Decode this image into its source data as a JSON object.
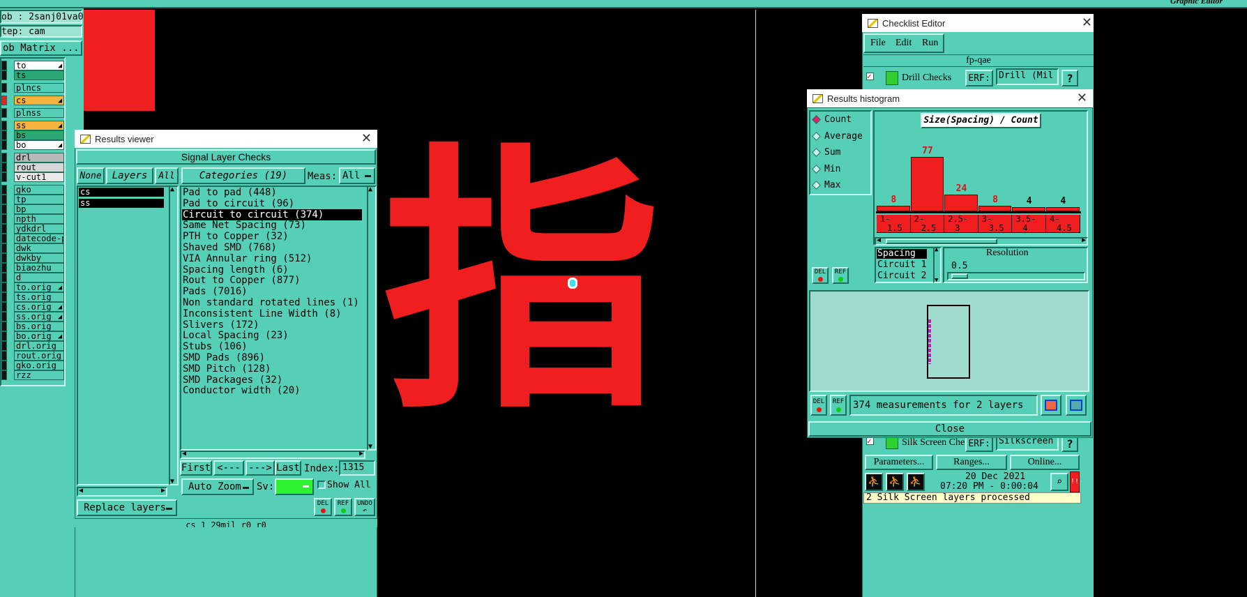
{
  "left_panel": {
    "job": "ob : 2sanj01va0",
    "step": "tep: cam",
    "matrix_button": "ob Matrix ...",
    "layers": [
      {
        "name": "to",
        "color": "#ffffff",
        "arrow": "◢"
      },
      {
        "name": "ts",
        "color": "#2aa876",
        "arrow": ""
      },
      {
        "name": "plncs",
        "color": "#56cfb7",
        "arrow": ""
      },
      {
        "name": "cs",
        "color": "#f5b340",
        "arrow": "◢"
      },
      {
        "name": "plnss",
        "color": "#56cfb7",
        "arrow": ""
      },
      {
        "name": "ss",
        "color": "#f5b340",
        "arrow": "◢"
      },
      {
        "name": "bs",
        "color": "#2aa876",
        "arrow": ""
      },
      {
        "name": "bo",
        "color": "#ffffff",
        "arrow": "◢"
      },
      {
        "name": "drl",
        "color": "#b9b9b9",
        "arrow": ""
      },
      {
        "name": "rout",
        "color": "#d6d6d6",
        "arrow": ""
      },
      {
        "name": "v-cut1",
        "color": "#e8e8e8",
        "arrow": ""
      },
      {
        "name": "gko",
        "color": "#56cfb7",
        "arrow": ""
      },
      {
        "name": "tp",
        "color": "#56cfb7",
        "arrow": ""
      },
      {
        "name": "bp",
        "color": "#56cfb7",
        "arrow": ""
      },
      {
        "name": "npth",
        "color": "#56cfb7",
        "arrow": ""
      },
      {
        "name": "ydkdrl",
        "color": "#56cfb7",
        "arrow": ""
      },
      {
        "name": "datecode-pt",
        "color": "#56cfb7",
        "arrow": ""
      },
      {
        "name": "dwk",
        "color": "#56cfb7",
        "arrow": ""
      },
      {
        "name": "dwkby",
        "color": "#56cfb7",
        "arrow": ""
      },
      {
        "name": "biaozhu",
        "color": "#56cfb7",
        "arrow": ""
      },
      {
        "name": "d",
        "color": "#56cfb7",
        "arrow": ""
      },
      {
        "name": "to.orig",
        "color": "#56cfb7",
        "arrow": "◢"
      },
      {
        "name": "ts.orig",
        "color": "#56cfb7",
        "arrow": ""
      },
      {
        "name": "cs.orig",
        "color": "#56cfb7",
        "arrow": "◢"
      },
      {
        "name": "ss.orig",
        "color": "#56cfb7",
        "arrow": "◢"
      },
      {
        "name": "bs.orig",
        "color": "#56cfb7",
        "arrow": ""
      },
      {
        "name": "bo.orig",
        "color": "#56cfb7",
        "arrow": "◢"
      },
      {
        "name": "drl.orig",
        "color": "#56cfb7",
        "arrow": ""
      },
      {
        "name": "rout.orig",
        "color": "#56cfb7",
        "arrow": ""
      },
      {
        "name": "gko.orig",
        "color": "#56cfb7",
        "arrow": ""
      },
      {
        "name": "rzz",
        "color": "#56cfb7",
        "arrow": ""
      }
    ]
  },
  "top_right_title": "Graphic Editor",
  "canvas_char": "指",
  "results_viewer": {
    "title": "Results viewer",
    "header": "Signal Layer Checks",
    "none_btn": "None",
    "layers_btn": "Layers",
    "all_btn": "All",
    "categories_btn": "Categories (19)",
    "meas_label": "Meas:",
    "meas_value": "All",
    "layers": [
      "cs",
      "ss"
    ],
    "categories": [
      "Pad to pad (448)",
      "Pad to circuit (96)",
      "Circuit to circuit (374)",
      "Same Net Spacing (73)",
      "PTH to Copper (32)",
      "Shaved SMD (768)",
      "VIA Annular ring (512)",
      "Spacing length (6)",
      "Rout to Copper (877)",
      "Pads (7016)",
      "Non standard rotated lines (1)",
      "Inconsistent Line Width (8)",
      "Slivers (172)",
      "Local Spacing (23)",
      "Stubs (106)",
      "SMD Pads (896)",
      "SMD Pitch (128)",
      "SMD Packages (32)",
      "Conductor width (20)"
    ],
    "selected_category_index": 2,
    "first_btn": "First",
    "prev_btn": "<---",
    "next_btn": "--->",
    "last_btn": "Last",
    "index_label": "Index:",
    "index_value": "1315",
    "auto_zoom": "Auto Zoom",
    "sv_label": "Sv:",
    "show_all": "Show All",
    "replace_layers": "Replace layers",
    "del": "DEL",
    "ref": "REF",
    "undo": "UNDO",
    "status": "cs 1 29mil  r0  r0"
  },
  "checklist_editor": {
    "title": "Checklist Editor",
    "menu": [
      "File",
      "Edit",
      "Run"
    ],
    "name": "fp-qae",
    "drill_row": {
      "label": "Drill Checks",
      "erf": "ERF:",
      "value": "Drill (Mil"
    },
    "silk_row": {
      "label": "Silk Screen Che",
      "erf": "ERF:",
      "value": "Silkscreen"
    },
    "parameters_btn": "Parameters...",
    "ranges_btn": "Ranges...",
    "online_btn": "Online...",
    "date": "20 Dec 2021",
    "time": "07:20 PM - 0:00:04",
    "status": "2 Silk Screen layers processed"
  },
  "histogram": {
    "title": "Results histogram",
    "modes": [
      "Count",
      "Average",
      "Sum",
      "Min",
      "Max"
    ],
    "selected_mode": "Count",
    "chart_title": "Size(Spacing) / Count",
    "attr_list": [
      "Spacing",
      "Circuit 1",
      "Circuit 2"
    ],
    "resolution_label": "Resolution",
    "resolution_value": "0.5",
    "summary": "374 measurements for 2 layers",
    "close_btn": "Close",
    "del": "DEL",
    "ref": "REF"
  },
  "chart_data": {
    "type": "bar",
    "title": "Size(Spacing) / Count",
    "categories": [
      "1-1.5",
      "2-2.5",
      "2.5-3",
      "3-3.5",
      "3.5-4",
      "4-4.5"
    ],
    "category_labels_top": [
      "1-",
      "2-",
      "2.5-",
      "3-",
      "3.5-",
      "4-"
    ],
    "category_labels_bottom": [
      "1.5",
      "2.5",
      "3",
      "3.5",
      "4",
      "4.5"
    ],
    "values": [
      8,
      77,
      24,
      8,
      4,
      4
    ],
    "value_label_colors": [
      "#e11111",
      "#e11111",
      "#e11111",
      "#e11111",
      "#000000",
      "#000000"
    ],
    "bar_color": "#f01e1e",
    "ylim": [
      0,
      77
    ]
  }
}
